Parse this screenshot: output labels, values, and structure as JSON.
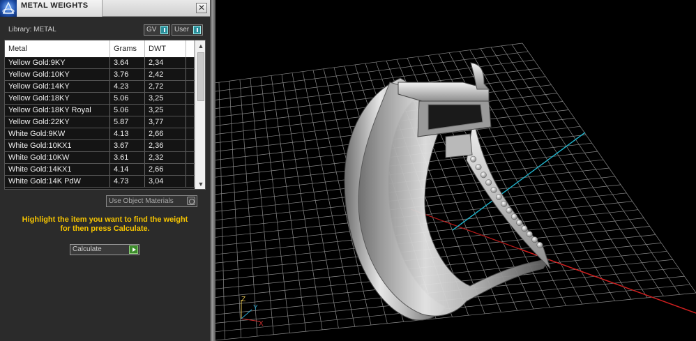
{
  "window": {
    "title": "METAL WEIGHTS",
    "close_glyph": "✕"
  },
  "library": {
    "label": "Library: METAL",
    "toggles": [
      {
        "label": "GV",
        "state": "on"
      },
      {
        "label": "User",
        "state": "on"
      }
    ]
  },
  "table": {
    "columns": [
      "Metal",
      "Grams",
      "DWT"
    ],
    "rows": [
      {
        "metal": "Yellow Gold:9KY",
        "grams": "3.64",
        "dwt": "2,34"
      },
      {
        "metal": "Yellow Gold:10KY",
        "grams": "3.76",
        "dwt": "2,42"
      },
      {
        "metal": "Yellow Gold:14KY",
        "grams": "4.23",
        "dwt": "2,72"
      },
      {
        "metal": "Yellow Gold:18KY",
        "grams": "5.06",
        "dwt": "3,25"
      },
      {
        "metal": "Yellow Gold:18KY Royal",
        "grams": "5.06",
        "dwt": "3,25"
      },
      {
        "metal": "Yellow Gold:22KY",
        "grams": "5.87",
        "dwt": "3,77"
      },
      {
        "metal": "White Gold:9KW",
        "grams": "4.13",
        "dwt": "2,66"
      },
      {
        "metal": "White Gold:10KX1",
        "grams": "3.67",
        "dwt": "2,36"
      },
      {
        "metal": "White Gold:10KW",
        "grams": "3.61",
        "dwt": "2,32"
      },
      {
        "metal": "White Gold:14KX1",
        "grams": "4.14",
        "dwt": "2,66"
      },
      {
        "metal": "White Gold:14K PdW",
        "grams": "4.73",
        "dwt": "3,04"
      }
    ]
  },
  "use_object_materials": {
    "label": "Use Object Materials"
  },
  "hint": {
    "line1": "Highlight the item you want to find the weight",
    "line2": "for then press Calculate."
  },
  "calculate": {
    "label": "Calculate"
  },
  "viewport": {
    "axis_labels": {
      "z": "Z",
      "y": "Y",
      "x": "X"
    },
    "colors": {
      "grid": "#8a8a8a",
      "x_axis": "#d11f1f",
      "y_axis": "#1fb0c8",
      "metal": "#c9c9c9"
    }
  }
}
